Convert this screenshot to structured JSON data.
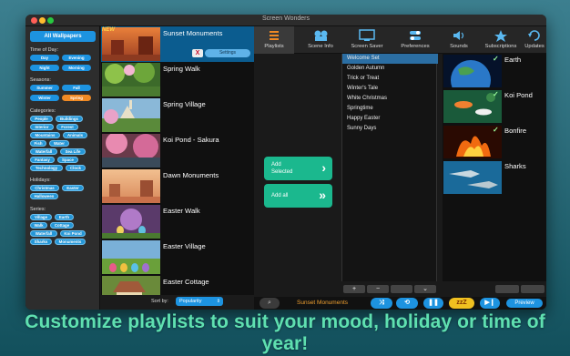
{
  "window": {
    "title": "Screen Wonders"
  },
  "sidebar": {
    "all_wallpapers": "All Wallpapers",
    "time_of_day": {
      "label": "Time of Day:",
      "items": [
        "Day",
        "Evening",
        "Night",
        "Morning"
      ]
    },
    "seasons": {
      "label": "Seasons:",
      "items": [
        "Summer",
        "Fall",
        "Winter",
        "Spring"
      ],
      "selected": "Spring"
    },
    "categories": {
      "label": "Categories:",
      "items": [
        "People",
        "Buildings",
        "Interior",
        "Forest",
        "Mountains",
        "Animals",
        "Fish",
        "Water",
        "Waterfall",
        "Sea Life",
        "Fantasy",
        "Space",
        "Technology",
        "Clock"
      ]
    },
    "holidays": {
      "label": "Holidays:",
      "items": [
        "Christmas",
        "Easter",
        "Halloween"
      ]
    },
    "series": {
      "label": "Series:",
      "items": [
        "Village",
        "Earth",
        "Walk",
        "Cottage",
        "Waterfall",
        "Koi Pond",
        "Sharks",
        "Monuments"
      ]
    }
  },
  "wallpapers": {
    "items": [
      {
        "name": "Sunset Monuments",
        "badge": "NEW",
        "selected": true
      },
      {
        "name": "Spring Walk"
      },
      {
        "name": "Spring Village"
      },
      {
        "name": "Koi Pond - Sakura"
      },
      {
        "name": "Dawn Monuments"
      },
      {
        "name": "Easter Walk"
      },
      {
        "name": "Easter Village"
      },
      {
        "name": "Easter Cottage"
      }
    ],
    "remove_label": "X",
    "settings_label": "Settings",
    "sort": {
      "label": "Sort by:",
      "value": "Popularity"
    }
  },
  "tabs": [
    {
      "label": "Playlists",
      "icon": "playlist-icon",
      "active": true
    },
    {
      "label": "Scene Info",
      "icon": "film-icon"
    },
    {
      "label": "Screen Saver",
      "icon": "monitor-icon"
    },
    {
      "label": "Preferences",
      "icon": "switches-icon"
    },
    {
      "label": "Sounds",
      "icon": "speaker-icon"
    },
    {
      "label": "Subscriptions",
      "icon": "star-icon"
    },
    {
      "label": "Updates",
      "icon": "refresh-icon"
    }
  ],
  "actions": {
    "add_selected": "Add\nSelected",
    "add_all": "Add all"
  },
  "playlists": {
    "items": [
      "Welcome Set",
      "Golden Autumn",
      "Trick or Treat",
      "Winter's Tale",
      "White Christmas",
      "Springtime",
      "Happy Easter",
      "Sunny Days"
    ],
    "selected": "Welcome Set",
    "tools": [
      "+",
      "−",
      "",
      "⌄"
    ]
  },
  "scenes": {
    "items": [
      {
        "name": "Earth",
        "checked": true
      },
      {
        "name": "Koi Pond",
        "checked": true
      },
      {
        "name": "Bonfire",
        "checked": true
      },
      {
        "name": "Sharks"
      }
    ]
  },
  "player": {
    "now_playing": "Sunset Monuments",
    "preview_label": "Preview",
    "sleep_label": "zzZ"
  },
  "caption": "Customize playlists to suit your mood, holiday or time of year!",
  "colors": {
    "accent": "#1d93e0",
    "selected_pill": "#f08a24",
    "add_button": "#1bb88e",
    "caption": "#5fe0b0"
  }
}
